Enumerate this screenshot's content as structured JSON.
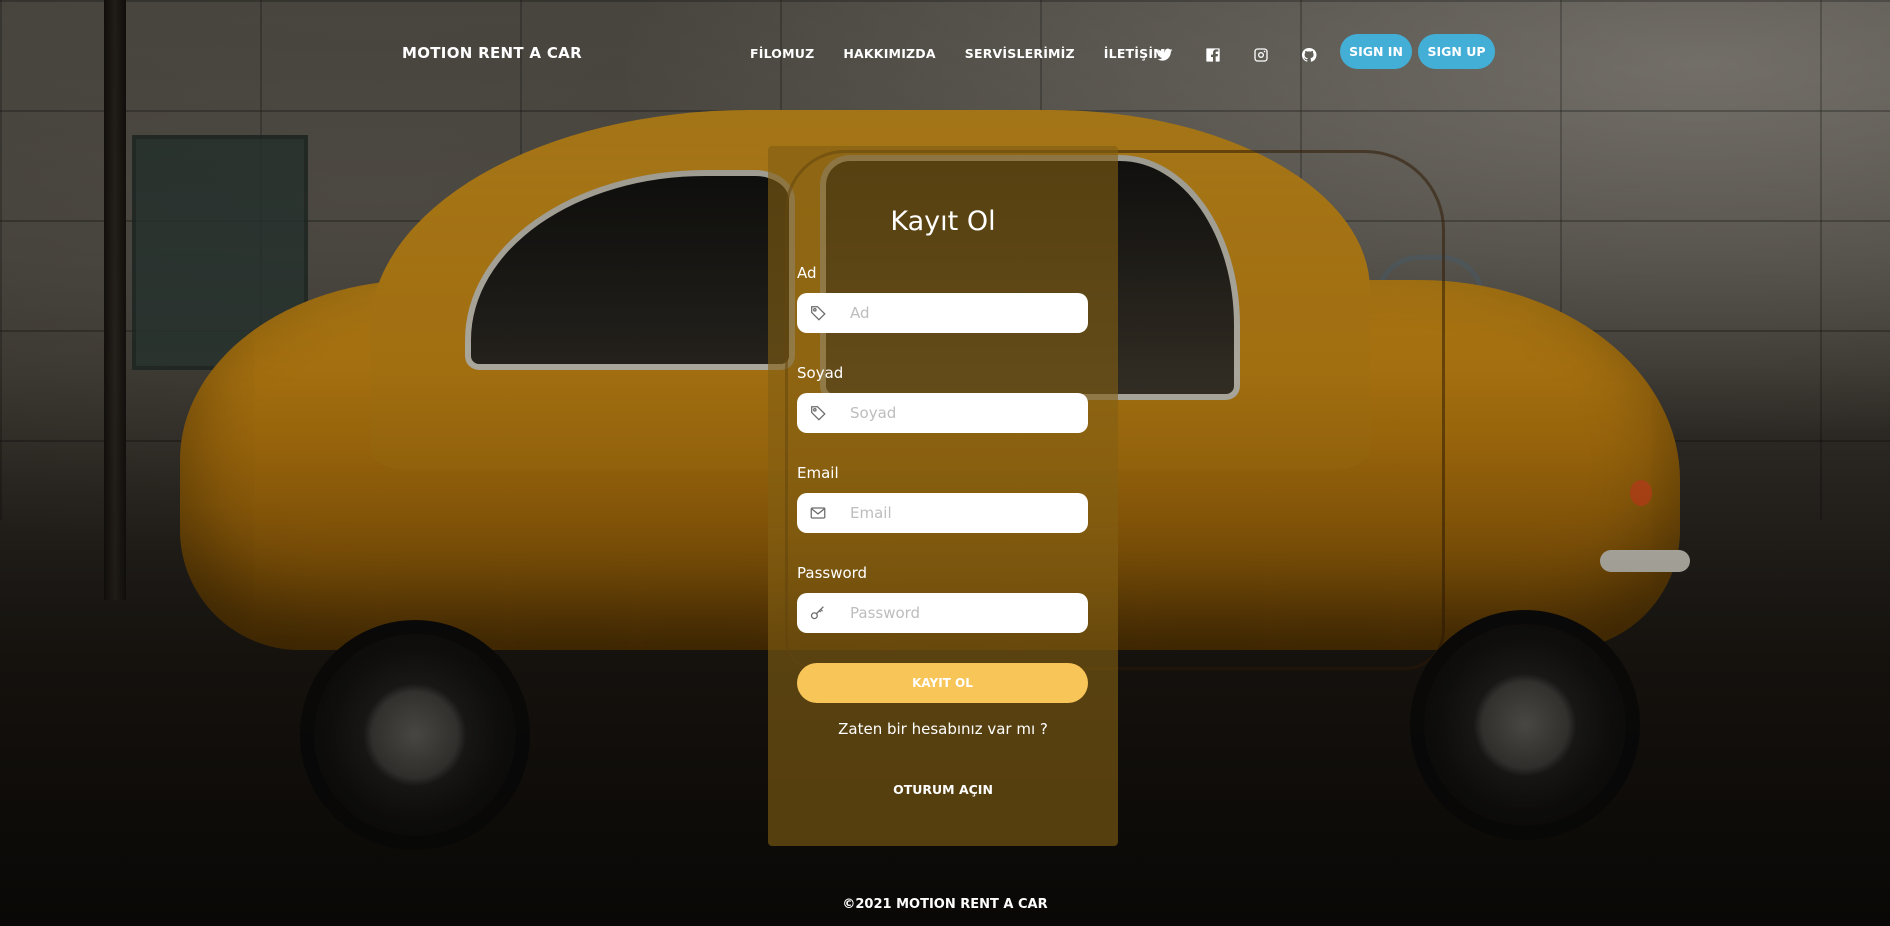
{
  "brand": "MOTION RENT A CAR",
  "nav": {
    "links": [
      "FİLOMUZ",
      "HAKKIMIZDA",
      "SERVİSLERİMİZ",
      "İLETİŞİM"
    ],
    "social_icons": [
      "twitter-icon",
      "facebook-icon",
      "instagram-icon",
      "github-icon"
    ],
    "sign_in": "SIGN IN",
    "sign_up": "SIGN UP"
  },
  "form": {
    "title": "Kayıt Ol",
    "fields": [
      {
        "label": "Ad",
        "placeholder": "Ad",
        "icon": "tag-icon",
        "value": ""
      },
      {
        "label": "Soyad",
        "placeholder": "Soyad",
        "icon": "tag-icon",
        "value": ""
      },
      {
        "label": "Email",
        "placeholder": "Email",
        "icon": "envelope-icon",
        "value": ""
      },
      {
        "label": "Password",
        "placeholder": "Password",
        "icon": "key-icon",
        "value": ""
      }
    ],
    "submit": "KAYIT OL",
    "have_account": "Zaten bir hesabınız var mı ?",
    "login_link": "OTURUM AÇIN"
  },
  "footer": "©2021 MOTION RENT A CAR",
  "colors": {
    "accent_blue": "#44afd6",
    "accent_yellow": "#f8c558",
    "card_bg": "#82601499"
  }
}
